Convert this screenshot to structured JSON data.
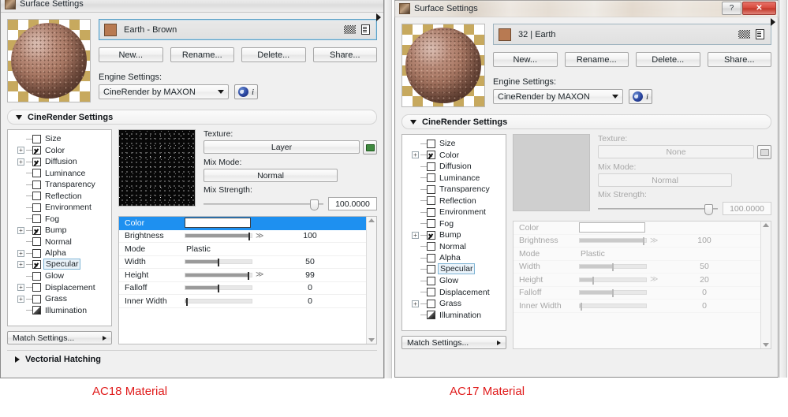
{
  "left_window": {
    "title": "Surface Settings",
    "material": {
      "name": "Earth - Brown",
      "swatch_color": "#b87a52"
    },
    "buttons": {
      "new": "New...",
      "rename": "Rename...",
      "delete": "Delete...",
      "share": "Share..."
    },
    "engine": {
      "label": "Engine Settings:",
      "value": "CineRender by MAXON"
    },
    "section_header": "CineRender Settings",
    "vectorial_header": "Vectorial Hatching",
    "match_settings": "Match Settings...",
    "tree": [
      {
        "label": "Size",
        "checked": false,
        "expandable": false,
        "selected": false,
        "special": "size"
      },
      {
        "label": "Color",
        "checked": true,
        "expandable": true,
        "selected": false
      },
      {
        "label": "Diffusion",
        "checked": true,
        "expandable": true,
        "selected": false
      },
      {
        "label": "Luminance",
        "checked": false,
        "expandable": false,
        "selected": false
      },
      {
        "label": "Transparency",
        "checked": false,
        "expandable": false,
        "selected": false
      },
      {
        "label": "Reflection",
        "checked": false,
        "expandable": false,
        "selected": false
      },
      {
        "label": "Environment",
        "checked": false,
        "expandable": false,
        "selected": false
      },
      {
        "label": "Fog",
        "checked": false,
        "expandable": false,
        "selected": false
      },
      {
        "label": "Bump",
        "checked": true,
        "expandable": true,
        "selected": false
      },
      {
        "label": "Normal",
        "checked": false,
        "expandable": false,
        "selected": false
      },
      {
        "label": "Alpha",
        "checked": false,
        "expandable": true,
        "selected": false
      },
      {
        "label": "Specular",
        "checked": true,
        "expandable": true,
        "selected": true
      },
      {
        "label": "Glow",
        "checked": false,
        "expandable": false,
        "selected": false
      },
      {
        "label": "Displacement",
        "checked": false,
        "expandable": true,
        "selected": false
      },
      {
        "label": "Grass",
        "checked": false,
        "expandable": true,
        "selected": false
      },
      {
        "label": "Illumination",
        "checked": false,
        "expandable": false,
        "selected": false,
        "special": "illum"
      }
    ],
    "texture": {
      "label": "Texture:",
      "value": "Layer",
      "mix_mode_label": "Mix Mode:",
      "mix_mode_value": "Normal",
      "mix_strength_label": "Mix Strength:",
      "mix_strength_value": "100.0000"
    },
    "properties": [
      {
        "name": "Color",
        "type": "color",
        "value": ""
      },
      {
        "name": "Brightness",
        "type": "slider",
        "value": "100",
        "fill_pct": 96
      },
      {
        "name": "Mode",
        "type": "text",
        "value": "Plastic"
      },
      {
        "name": "Width",
        "type": "slider",
        "value": "50",
        "fill_pct": 50
      },
      {
        "name": "Height",
        "type": "slider",
        "value": "99",
        "fill_pct": 95
      },
      {
        "name": "Falloff",
        "type": "slider",
        "value": "0",
        "fill_pct": 50
      },
      {
        "name": "Inner Width",
        "type": "slider",
        "value": "0",
        "fill_pct": 2
      }
    ]
  },
  "right_window": {
    "title": "Surface Settings",
    "window_buttons": {
      "help": "?",
      "close": "✕"
    },
    "material": {
      "name": "32 | Earth",
      "swatch_color": "#b87a52"
    },
    "buttons": {
      "new": "New...",
      "rename": "Rename...",
      "delete": "Delete...",
      "share": "Share..."
    },
    "engine": {
      "label": "Engine Settings:",
      "value": "CineRender by MAXON"
    },
    "section_header": "CineRender Settings",
    "match_settings": "Match Settings...",
    "tree": [
      {
        "label": "Size",
        "checked": false,
        "expandable": false,
        "selected": false,
        "special": "size"
      },
      {
        "label": "Color",
        "checked": true,
        "expandable": true,
        "selected": false
      },
      {
        "label": "Diffusion",
        "checked": false,
        "expandable": false,
        "selected": false
      },
      {
        "label": "Luminance",
        "checked": false,
        "expandable": false,
        "selected": false
      },
      {
        "label": "Transparency",
        "checked": false,
        "expandable": false,
        "selected": false
      },
      {
        "label": "Reflection",
        "checked": false,
        "expandable": false,
        "selected": false
      },
      {
        "label": "Environment",
        "checked": false,
        "expandable": false,
        "selected": false
      },
      {
        "label": "Fog",
        "checked": false,
        "expandable": false,
        "selected": false
      },
      {
        "label": "Bump",
        "checked": true,
        "expandable": true,
        "selected": false
      },
      {
        "label": "Normal",
        "checked": false,
        "expandable": false,
        "selected": false
      },
      {
        "label": "Alpha",
        "checked": false,
        "expandable": false,
        "selected": false
      },
      {
        "label": "Specular",
        "checked": false,
        "expandable": false,
        "selected": true
      },
      {
        "label": "Glow",
        "checked": false,
        "expandable": false,
        "selected": false
      },
      {
        "label": "Displacement",
        "checked": false,
        "expandable": false,
        "selected": false
      },
      {
        "label": "Grass",
        "checked": false,
        "expandable": true,
        "selected": false
      },
      {
        "label": "Illumination",
        "checked": false,
        "expandable": false,
        "selected": false,
        "special": "illum"
      }
    ],
    "texture": {
      "label": "Texture:",
      "value": "None",
      "mix_mode_label": "Mix Mode:",
      "mix_mode_value": "Normal",
      "mix_strength_label": "Mix Strength:",
      "mix_strength_value": "100.0000"
    },
    "properties": [
      {
        "name": "Color",
        "type": "color",
        "value": ""
      },
      {
        "name": "Brightness",
        "type": "slider",
        "value": "100",
        "fill_pct": 96
      },
      {
        "name": "Mode",
        "type": "text",
        "value": "Plastic"
      },
      {
        "name": "Width",
        "type": "slider",
        "value": "50",
        "fill_pct": 50
      },
      {
        "name": "Height",
        "type": "slider",
        "value": "20",
        "fill_pct": 20
      },
      {
        "name": "Falloff",
        "type": "slider",
        "value": "0",
        "fill_pct": 50
      },
      {
        "name": "Inner Width",
        "type": "slider",
        "value": "0",
        "fill_pct": 2
      }
    ]
  },
  "captions": {
    "left": "AC18 Material",
    "right": "AC17 Material",
    "color": "#e01b1b"
  }
}
